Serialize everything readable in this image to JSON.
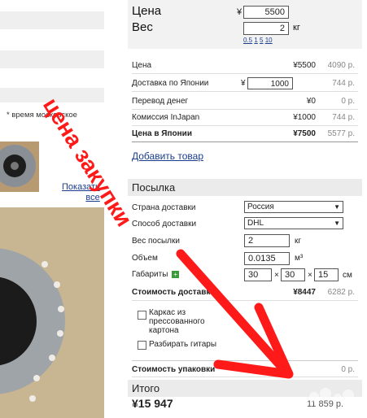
{
  "left": {
    "note": "* время московское",
    "show_all": [
      "Показать",
      "все"
    ]
  },
  "top": {
    "price_label": "Цена",
    "yen_symbol": "¥",
    "price_value": "5500",
    "weight_label": "Вес",
    "weight_value": "2",
    "weight_unit": "кг",
    "weight_presets": [
      "0.5",
      "1",
      "5",
      "10"
    ]
  },
  "cost_rows": [
    {
      "label": "Цена",
      "value": "¥5500",
      "rub": "4090 р."
    },
    {
      "label": "Доставка по Японии",
      "yen": "¥",
      "value": "1000",
      "rub": "744 р."
    },
    {
      "label": "Перевод денег",
      "value": "¥0",
      "rub": "0 р."
    },
    {
      "label": "Комиссия InJapan",
      "value": "¥1000",
      "rub": "744 р."
    },
    {
      "label": "Цена в Японии",
      "value": "¥7500",
      "rub": "5577 р."
    }
  ],
  "add_item": "Добавить товар",
  "parcel": {
    "title": "Посылка",
    "country_label": "Страна доставки",
    "country_value": "Россия",
    "method_label": "Способ доставки",
    "method_value": "DHL",
    "weight_label": "Вес посылки",
    "weight_value": "2",
    "weight_unit": "кг",
    "volume_label": "Объем",
    "volume_value": "0.0135",
    "volume_unit": "м³",
    "dims_label": "Габариты",
    "dims": [
      "30",
      "30",
      "15"
    ],
    "dims_x": "×",
    "dims_unit": "см",
    "shipping_cost_label": "Стоимость доставки",
    "shipping_cost_value": "¥8447",
    "shipping_cost_rub": "6282 р.",
    "options": [
      {
        "label": "Каркас из прессованного картона"
      },
      {
        "label": "Разбирать гитары"
      }
    ],
    "packing_label": "Стоимость упаковки",
    "packing_rub": "0 р."
  },
  "total": {
    "title": "Итого",
    "yen": "¥15 947",
    "rub": "11 859 р."
  },
  "annotation": {
    "text": "цена закупки",
    "color": "#ff1a1a"
  },
  "watermark": "avito-logo"
}
